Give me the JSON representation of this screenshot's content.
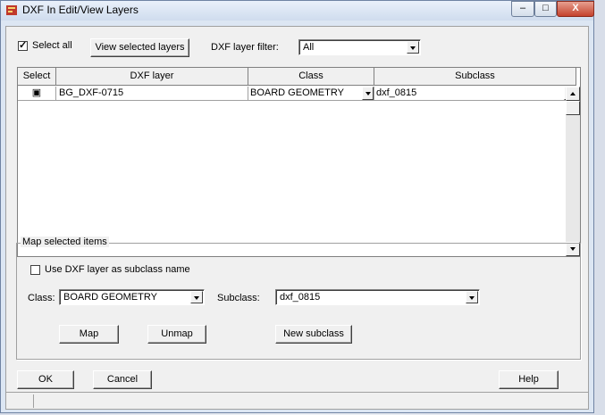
{
  "window": {
    "title": "DXF In Edit/View Layers",
    "minimize_symbol": "–",
    "maximize_symbol": "□",
    "close_symbol": "X"
  },
  "toolbar": {
    "select_all_label": "Select all",
    "select_all_checked": true,
    "view_selected_label": "View selected layers",
    "filter_label": "DXF layer filter:",
    "filter_value": "All"
  },
  "grid": {
    "columns": [
      "Select",
      "DXF layer",
      "Class",
      "Subclass"
    ],
    "rows": [
      {
        "selected": true,
        "select_mark": "▣",
        "dxf_layer": "BG_DXF-0715",
        "class": "BOARD GEOMETRY",
        "subclass": "dxf_0815"
      }
    ]
  },
  "map_group": {
    "label": "Map selected items",
    "use_dxf_label": "Use DXF layer as subclass name",
    "use_dxf_checked": false,
    "class_label": "Class:",
    "class_value": "BOARD GEOMETRY",
    "subclass_label": "Subclass:",
    "subclass_value": "dxf_0815",
    "map_label": "Map",
    "unmap_label": "Unmap",
    "new_subclass_label": "New subclass"
  },
  "footer": {
    "ok_label": "OK",
    "cancel_label": "Cancel",
    "help_label": "Help"
  },
  "icons": {
    "app_icon": "dxf-app-icon",
    "dropdown_icon": "chevron-down-icon",
    "scroll_up_icon": "scroll-up-icon",
    "scroll_down_icon": "scroll-down-icon"
  }
}
